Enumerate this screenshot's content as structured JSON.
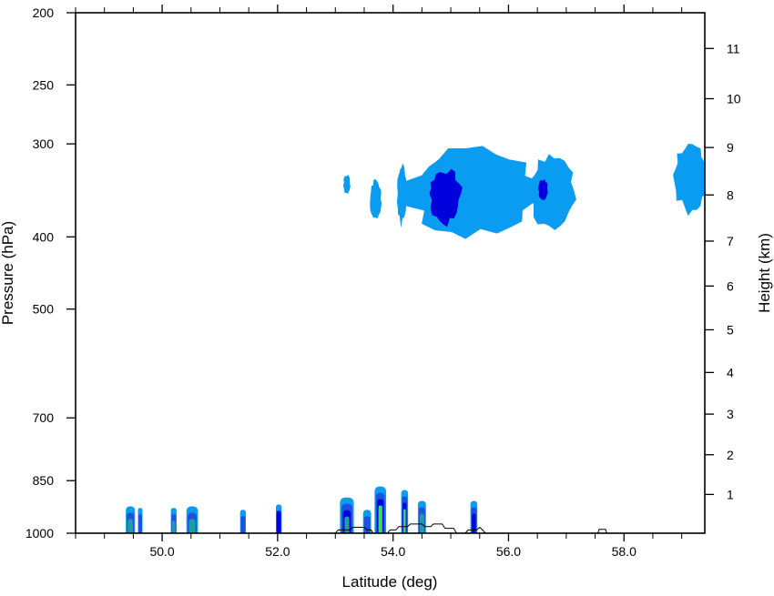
{
  "chart_data": {
    "type": "contour",
    "xlabel": "Latitude (deg)",
    "ylabel_left": "Pressure (hPa)",
    "ylabel_right": "Height (km)",
    "xlim": [
      48.5,
      59.4
    ],
    "pressure_scale": "log",
    "pressure_range": [
      1000,
      200
    ],
    "x_ticks": [
      {
        "value": 50.0,
        "label": "50.0"
      },
      {
        "value": 52.0,
        "label": "52.0"
      },
      {
        "value": 54.0,
        "label": "54.0"
      },
      {
        "value": 56.0,
        "label": "56.0"
      },
      {
        "value": 58.0,
        "label": "58.0"
      }
    ],
    "x_minor_ticks": [
      48.5,
      49.0,
      49.5,
      50.5,
      51.0,
      51.5,
      52.5,
      53.0,
      53.5,
      54.5,
      55.0,
      55.5,
      56.5,
      57.0,
      57.5,
      58.5,
      59.0
    ],
    "pressure_ticks": [
      {
        "value": 200,
        "label": "200"
      },
      {
        "value": 250,
        "label": "250"
      },
      {
        "value": 300,
        "label": "300"
      },
      {
        "value": 400,
        "label": "400"
      },
      {
        "value": 500,
        "label": "500"
      },
      {
        "value": 700,
        "label": "700"
      },
      {
        "value": 850,
        "label": "850"
      },
      {
        "value": 1000,
        "label": "1000"
      }
    ],
    "height_ticks": [
      {
        "value": 1,
        "label": "1"
      },
      {
        "value": 2,
        "label": "2"
      },
      {
        "value": 3,
        "label": "3"
      },
      {
        "value": 4,
        "label": "4"
      },
      {
        "value": 5,
        "label": "5"
      },
      {
        "value": 6,
        "label": "6"
      },
      {
        "value": 7,
        "label": "7"
      },
      {
        "value": 8,
        "label": "8"
      },
      {
        "value": 9,
        "label": "9"
      },
      {
        "value": 10,
        "label": "10"
      },
      {
        "value": 11,
        "label": "11"
      }
    ],
    "colors": {
      "level1": "#0a9cf0",
      "level2": "#1f50e0",
      "level3": "#0000dc",
      "level4": "#1aa0a0",
      "level5": "#36e05a",
      "terrain_line": "#000000"
    },
    "upper_clouds": [
      {
        "lat": 53.2,
        "p": 340,
        "lat_half_width": 0.06,
        "p_top": 330,
        "p_bottom": 350,
        "level": 1
      },
      {
        "lat": 53.7,
        "p": 355,
        "lat_half_width": 0.1,
        "p_top": 335,
        "p_bottom": 380,
        "level": 1
      },
      {
        "lat": 54.15,
        "p": 350,
        "lat_half_width": 0.08,
        "p_top": 320,
        "p_bottom": 385,
        "level": 1
      },
      {
        "lat": 55.4,
        "p": 350,
        "lat_half_width": 1.15,
        "p_top": 305,
        "p_bottom": 400,
        "level": 1
      },
      {
        "lat": 54.9,
        "p": 350,
        "lat_half_width": 0.28,
        "p_top": 325,
        "p_bottom": 385,
        "level": 3
      },
      {
        "lat": 56.75,
        "p": 345,
        "lat_half_width": 0.4,
        "p_top": 310,
        "p_bottom": 390,
        "level": 1
      },
      {
        "lat": 56.6,
        "p": 345,
        "lat_half_width": 0.08,
        "p_top": 335,
        "p_bottom": 358,
        "level": 3
      },
      {
        "lat": 59.15,
        "p": 330,
        "lat_half_width": 0.3,
        "p_top": 300,
        "p_bottom": 370,
        "level": 1
      }
    ],
    "low_clouds": [
      {
        "lat": 49.45,
        "p_top": 920,
        "half_width": 0.08,
        "levels": [
          1,
          2,
          4
        ]
      },
      {
        "lat": 49.62,
        "p_top": 925,
        "half_width": 0.03,
        "levels": [
          1,
          2
        ]
      },
      {
        "lat": 50.2,
        "p_top": 925,
        "half_width": 0.05,
        "levels": [
          1,
          2,
          4
        ]
      },
      {
        "lat": 50.52,
        "p_top": 920,
        "half_width": 0.1,
        "levels": [
          1,
          2,
          4
        ]
      },
      {
        "lat": 51.4,
        "p_top": 930,
        "half_width": 0.05,
        "levels": [
          1,
          2
        ]
      },
      {
        "lat": 52.02,
        "p_top": 915,
        "half_width": 0.05,
        "levels": [
          1,
          3
        ]
      },
      {
        "lat": 53.2,
        "p_top": 895,
        "half_width": 0.12,
        "levels": [
          1,
          2,
          3,
          4
        ]
      },
      {
        "lat": 53.55,
        "p_top": 930,
        "half_width": 0.07,
        "levels": [
          1,
          2
        ]
      },
      {
        "lat": 53.78,
        "p_top": 865,
        "half_width": 0.1,
        "levels": [
          1,
          2,
          3,
          5
        ]
      },
      {
        "lat": 54.2,
        "p_top": 875,
        "half_width": 0.06,
        "levels": [
          1,
          2,
          3,
          5
        ]
      },
      {
        "lat": 54.5,
        "p_top": 905,
        "half_width": 0.07,
        "levels": [
          1,
          2,
          4
        ]
      },
      {
        "lat": 55.4,
        "p_top": 905,
        "half_width": 0.06,
        "levels": [
          1,
          2,
          3
        ]
      }
    ],
    "terrain": [
      {
        "lat": 53.0,
        "p": 1000
      },
      {
        "lat": 53.05,
        "p": 990
      },
      {
        "lat": 53.25,
        "p": 990
      },
      {
        "lat": 53.3,
        "p": 982
      },
      {
        "lat": 53.5,
        "p": 982
      },
      {
        "lat": 53.55,
        "p": 990
      },
      {
        "lat": 53.62,
        "p": 990
      },
      {
        "lat": 53.65,
        "p": 1000
      },
      {
        "lat": 53.9,
        "p": 1000
      },
      {
        "lat": 53.95,
        "p": 990
      },
      {
        "lat": 54.05,
        "p": 990
      },
      {
        "lat": 54.1,
        "p": 980
      },
      {
        "lat": 54.25,
        "p": 980
      },
      {
        "lat": 54.3,
        "p": 972
      },
      {
        "lat": 54.5,
        "p": 972
      },
      {
        "lat": 54.55,
        "p": 980
      },
      {
        "lat": 54.65,
        "p": 980
      },
      {
        "lat": 54.7,
        "p": 972
      },
      {
        "lat": 54.85,
        "p": 972
      },
      {
        "lat": 54.9,
        "p": 985
      },
      {
        "lat": 55.05,
        "p": 985
      },
      {
        "lat": 55.1,
        "p": 1000
      },
      {
        "lat": 55.25,
        "p": 1000
      },
      {
        "lat": 55.3,
        "p": 990
      },
      {
        "lat": 55.45,
        "p": 990
      },
      {
        "lat": 55.5,
        "p": 982
      },
      {
        "lat": 55.55,
        "p": 990
      },
      {
        "lat": 55.6,
        "p": 1000
      },
      {
        "lat": 57.55,
        "p": 1000
      },
      {
        "lat": 57.57,
        "p": 988
      },
      {
        "lat": 57.68,
        "p": 988
      },
      {
        "lat": 57.7,
        "p": 1000
      }
    ]
  }
}
